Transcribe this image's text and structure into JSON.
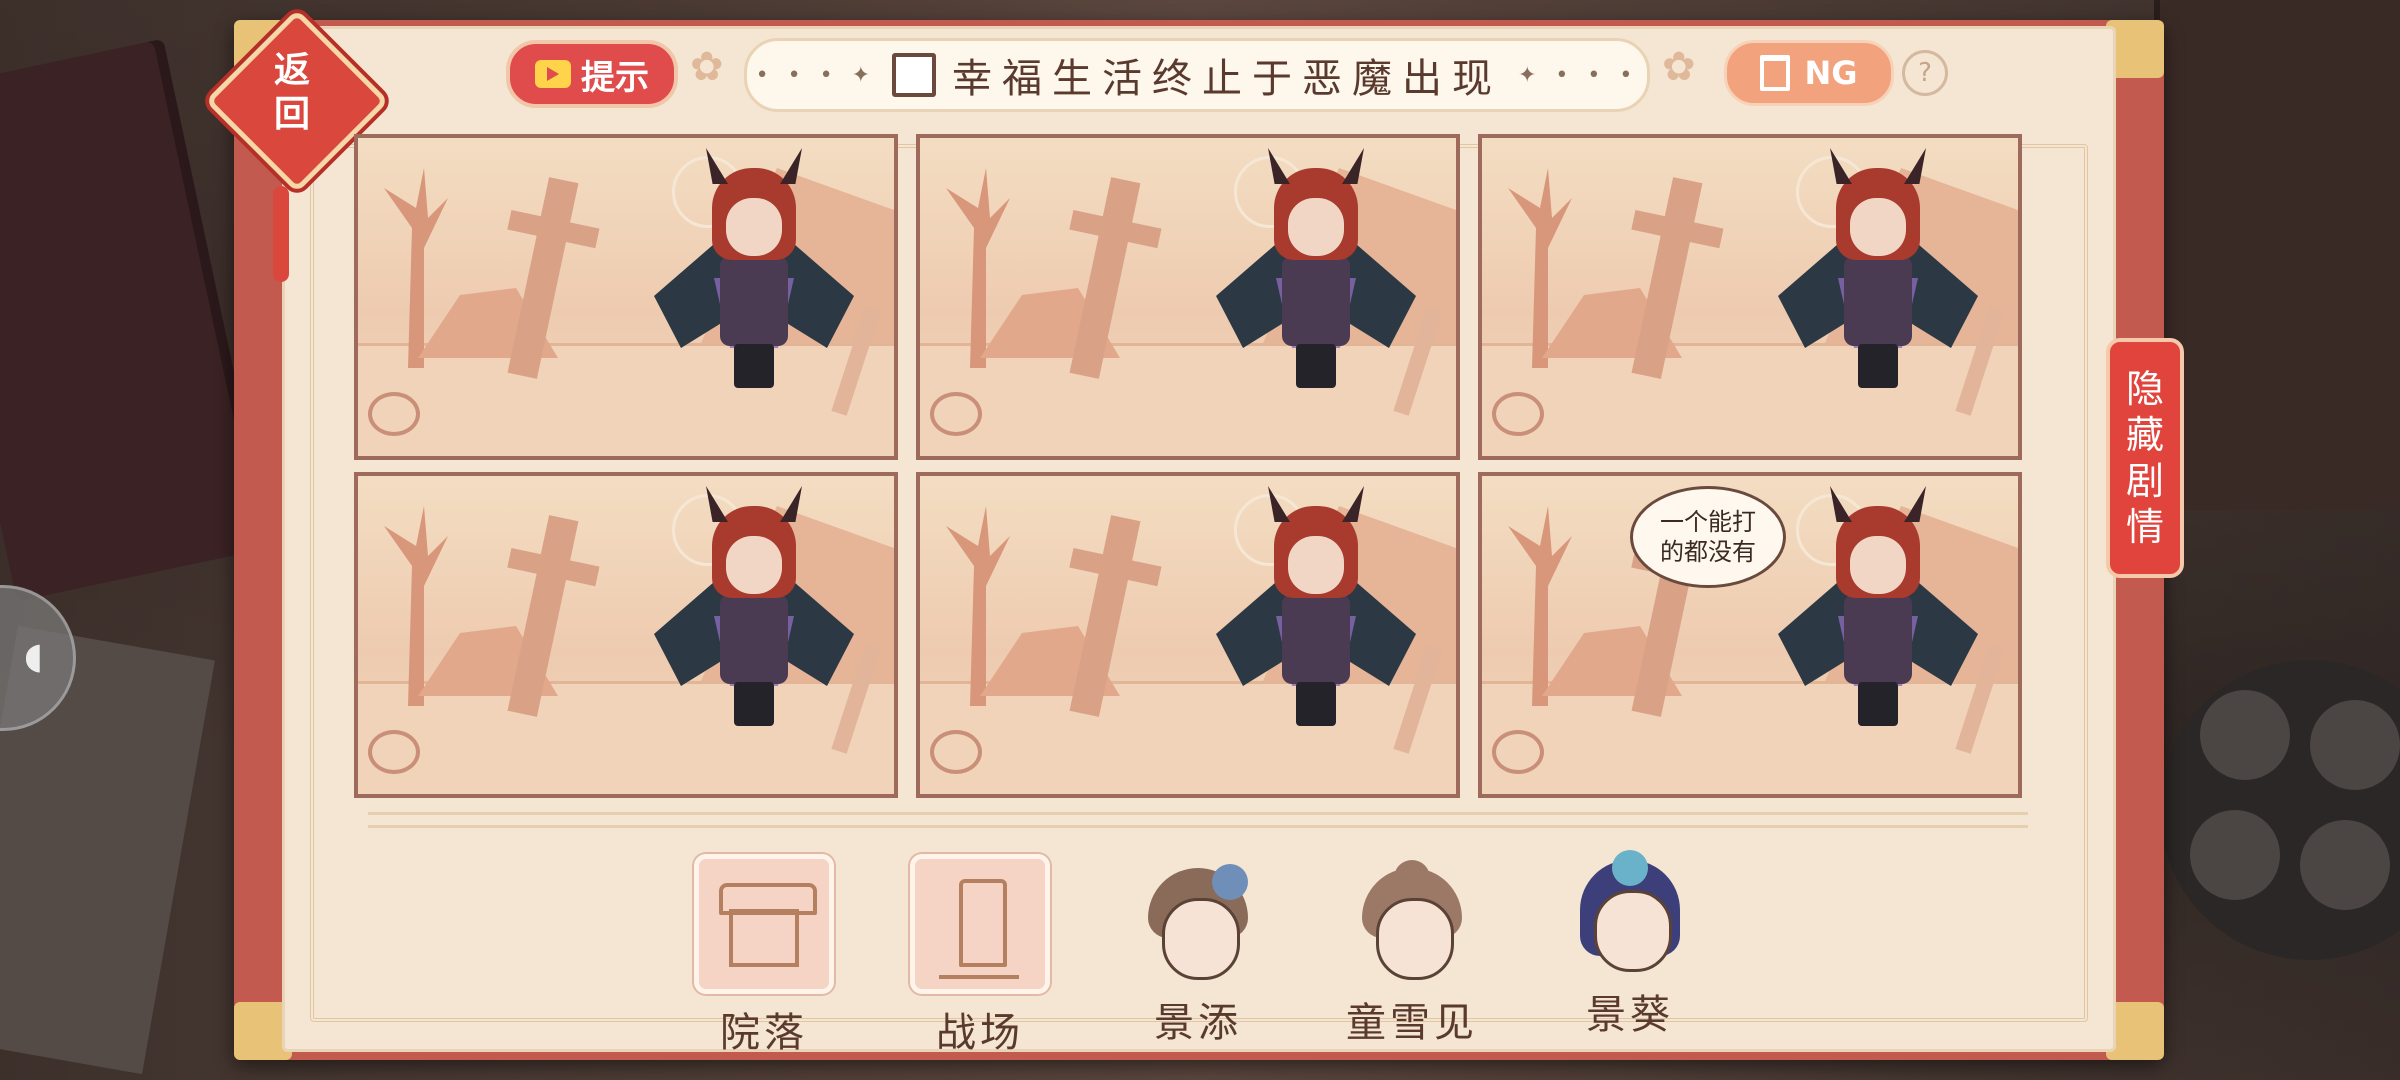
{
  "header": {
    "back_label": "返回",
    "hint_label": "提示",
    "title": "幸福生活终止于恶魔出现",
    "title_deco_left": "• • • ✦",
    "title_deco_right": "✦ • • •",
    "ng_label": "NG",
    "help_label": "?"
  },
  "side_tab": {
    "label_chars": [
      "隐",
      "藏",
      "剧",
      "情"
    ]
  },
  "panels": [
    {
      "id": 1,
      "speech": ""
    },
    {
      "id": 2,
      "speech": ""
    },
    {
      "id": 3,
      "speech": ""
    },
    {
      "id": 4,
      "speech": ""
    },
    {
      "id": 5,
      "speech": ""
    },
    {
      "id": 6,
      "speech_line1": "一个能打",
      "speech_line2": "的都没有"
    }
  ],
  "clues": [
    {
      "label": "院落",
      "icon": "courtyard-icon",
      "kind": "place"
    },
    {
      "label": "战场",
      "icon": "battlefield-icon",
      "kind": "place"
    },
    {
      "label": "景添",
      "icon": "jingtian-avatar",
      "kind": "character"
    },
    {
      "label": "童雪见",
      "icon": "tongxuejian-avatar",
      "kind": "character"
    },
    {
      "label": "景葵",
      "icon": "jingkui-avatar",
      "kind": "character"
    }
  ],
  "colors": {
    "accent_red": "#e04b4b",
    "paper": "#f4e6d2",
    "frame": "#c25a4f",
    "ng_orange": "#f2a27c"
  }
}
